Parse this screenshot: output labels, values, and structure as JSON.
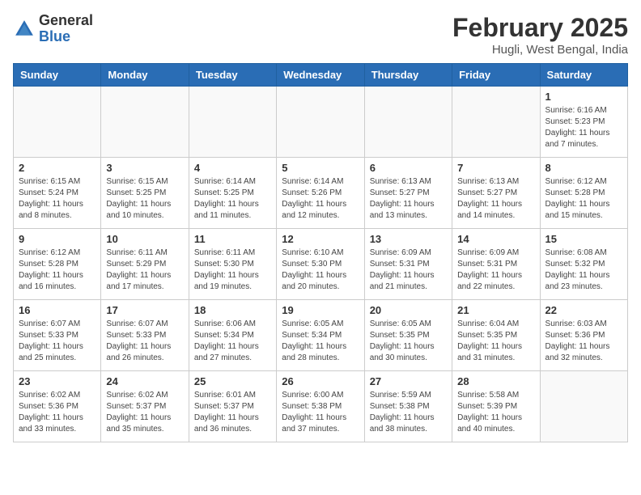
{
  "header": {
    "logo_general": "General",
    "logo_blue": "Blue",
    "month_title": "February 2025",
    "location": "Hugli, West Bengal, India"
  },
  "weekdays": [
    "Sunday",
    "Monday",
    "Tuesday",
    "Wednesday",
    "Thursday",
    "Friday",
    "Saturday"
  ],
  "weeks": [
    [
      {
        "day": "",
        "detail": ""
      },
      {
        "day": "",
        "detail": ""
      },
      {
        "day": "",
        "detail": ""
      },
      {
        "day": "",
        "detail": ""
      },
      {
        "day": "",
        "detail": ""
      },
      {
        "day": "",
        "detail": ""
      },
      {
        "day": "1",
        "detail": "Sunrise: 6:16 AM\nSunset: 5:23 PM\nDaylight: 11 hours and 7 minutes."
      }
    ],
    [
      {
        "day": "2",
        "detail": "Sunrise: 6:15 AM\nSunset: 5:24 PM\nDaylight: 11 hours and 8 minutes."
      },
      {
        "day": "3",
        "detail": "Sunrise: 6:15 AM\nSunset: 5:25 PM\nDaylight: 11 hours and 10 minutes."
      },
      {
        "day": "4",
        "detail": "Sunrise: 6:14 AM\nSunset: 5:25 PM\nDaylight: 11 hours and 11 minutes."
      },
      {
        "day": "5",
        "detail": "Sunrise: 6:14 AM\nSunset: 5:26 PM\nDaylight: 11 hours and 12 minutes."
      },
      {
        "day": "6",
        "detail": "Sunrise: 6:13 AM\nSunset: 5:27 PM\nDaylight: 11 hours and 13 minutes."
      },
      {
        "day": "7",
        "detail": "Sunrise: 6:13 AM\nSunset: 5:27 PM\nDaylight: 11 hours and 14 minutes."
      },
      {
        "day": "8",
        "detail": "Sunrise: 6:12 AM\nSunset: 5:28 PM\nDaylight: 11 hours and 15 minutes."
      }
    ],
    [
      {
        "day": "9",
        "detail": "Sunrise: 6:12 AM\nSunset: 5:28 PM\nDaylight: 11 hours and 16 minutes."
      },
      {
        "day": "10",
        "detail": "Sunrise: 6:11 AM\nSunset: 5:29 PM\nDaylight: 11 hours and 17 minutes."
      },
      {
        "day": "11",
        "detail": "Sunrise: 6:11 AM\nSunset: 5:30 PM\nDaylight: 11 hours and 19 minutes."
      },
      {
        "day": "12",
        "detail": "Sunrise: 6:10 AM\nSunset: 5:30 PM\nDaylight: 11 hours and 20 minutes."
      },
      {
        "day": "13",
        "detail": "Sunrise: 6:09 AM\nSunset: 5:31 PM\nDaylight: 11 hours and 21 minutes."
      },
      {
        "day": "14",
        "detail": "Sunrise: 6:09 AM\nSunset: 5:31 PM\nDaylight: 11 hours and 22 minutes."
      },
      {
        "day": "15",
        "detail": "Sunrise: 6:08 AM\nSunset: 5:32 PM\nDaylight: 11 hours and 23 minutes."
      }
    ],
    [
      {
        "day": "16",
        "detail": "Sunrise: 6:07 AM\nSunset: 5:33 PM\nDaylight: 11 hours and 25 minutes."
      },
      {
        "day": "17",
        "detail": "Sunrise: 6:07 AM\nSunset: 5:33 PM\nDaylight: 11 hours and 26 minutes."
      },
      {
        "day": "18",
        "detail": "Sunrise: 6:06 AM\nSunset: 5:34 PM\nDaylight: 11 hours and 27 minutes."
      },
      {
        "day": "19",
        "detail": "Sunrise: 6:05 AM\nSunset: 5:34 PM\nDaylight: 11 hours and 28 minutes."
      },
      {
        "day": "20",
        "detail": "Sunrise: 6:05 AM\nSunset: 5:35 PM\nDaylight: 11 hours and 30 minutes."
      },
      {
        "day": "21",
        "detail": "Sunrise: 6:04 AM\nSunset: 5:35 PM\nDaylight: 11 hours and 31 minutes."
      },
      {
        "day": "22",
        "detail": "Sunrise: 6:03 AM\nSunset: 5:36 PM\nDaylight: 11 hours and 32 minutes."
      }
    ],
    [
      {
        "day": "23",
        "detail": "Sunrise: 6:02 AM\nSunset: 5:36 PM\nDaylight: 11 hours and 33 minutes."
      },
      {
        "day": "24",
        "detail": "Sunrise: 6:02 AM\nSunset: 5:37 PM\nDaylight: 11 hours and 35 minutes."
      },
      {
        "day": "25",
        "detail": "Sunrise: 6:01 AM\nSunset: 5:37 PM\nDaylight: 11 hours and 36 minutes."
      },
      {
        "day": "26",
        "detail": "Sunrise: 6:00 AM\nSunset: 5:38 PM\nDaylight: 11 hours and 37 minutes."
      },
      {
        "day": "27",
        "detail": "Sunrise: 5:59 AM\nSunset: 5:38 PM\nDaylight: 11 hours and 38 minutes."
      },
      {
        "day": "28",
        "detail": "Sunrise: 5:58 AM\nSunset: 5:39 PM\nDaylight: 11 hours and 40 minutes."
      },
      {
        "day": "",
        "detail": ""
      }
    ]
  ]
}
